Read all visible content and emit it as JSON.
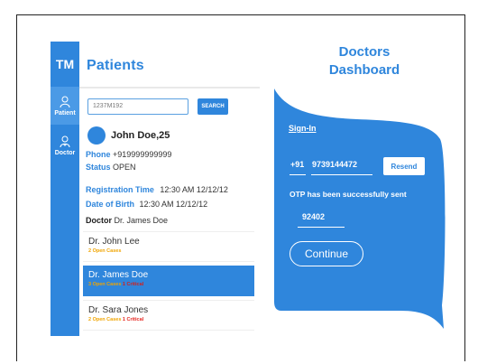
{
  "sidebar": {
    "brand": "TM",
    "items": [
      {
        "label": "Patient",
        "icon": "user-icon",
        "active": true
      },
      {
        "label": "Doctor",
        "icon": "doctor-icon",
        "active": false
      }
    ]
  },
  "patients": {
    "title": "Patients",
    "search": {
      "value": "1237M192",
      "button": "SEARCH"
    },
    "patient": {
      "name": "John Doe,25",
      "phone_label": "Phone",
      "phone": "+919999999999",
      "status_label": "Status",
      "status": "OPEN",
      "reg_label": "Registration Time",
      "reg": "12:30 AM 12/12/12",
      "dob_label": "Date of Birth",
      "dob": "12:30 AM 12/12/12",
      "doctor_label": "Doctor",
      "doctor": "Dr. James Doe"
    },
    "cases": [
      {
        "name": "Dr. John Lee",
        "open": "2 Open Cases",
        "critical": ""
      },
      {
        "name": "Dr. James Doe",
        "open": "3 Open Cases",
        "critical": "1 Critical"
      },
      {
        "name": "Dr. Sara Jones",
        "open": "2 Open Cases",
        "critical": "1 Critical"
      }
    ]
  },
  "dashboard": {
    "title_line1": "Doctors",
    "title_line2": "Dashboard",
    "signin": "Sign-In",
    "country_code": "+91",
    "phone": "9739144472",
    "resend": "Resend",
    "otp_message": "OTP has been successfully sent",
    "otp": "92402",
    "continue": "Continue"
  },
  "colors": {
    "accent": "#2f86dc",
    "open_cases": "#f0a400",
    "critical": "#e52620"
  }
}
